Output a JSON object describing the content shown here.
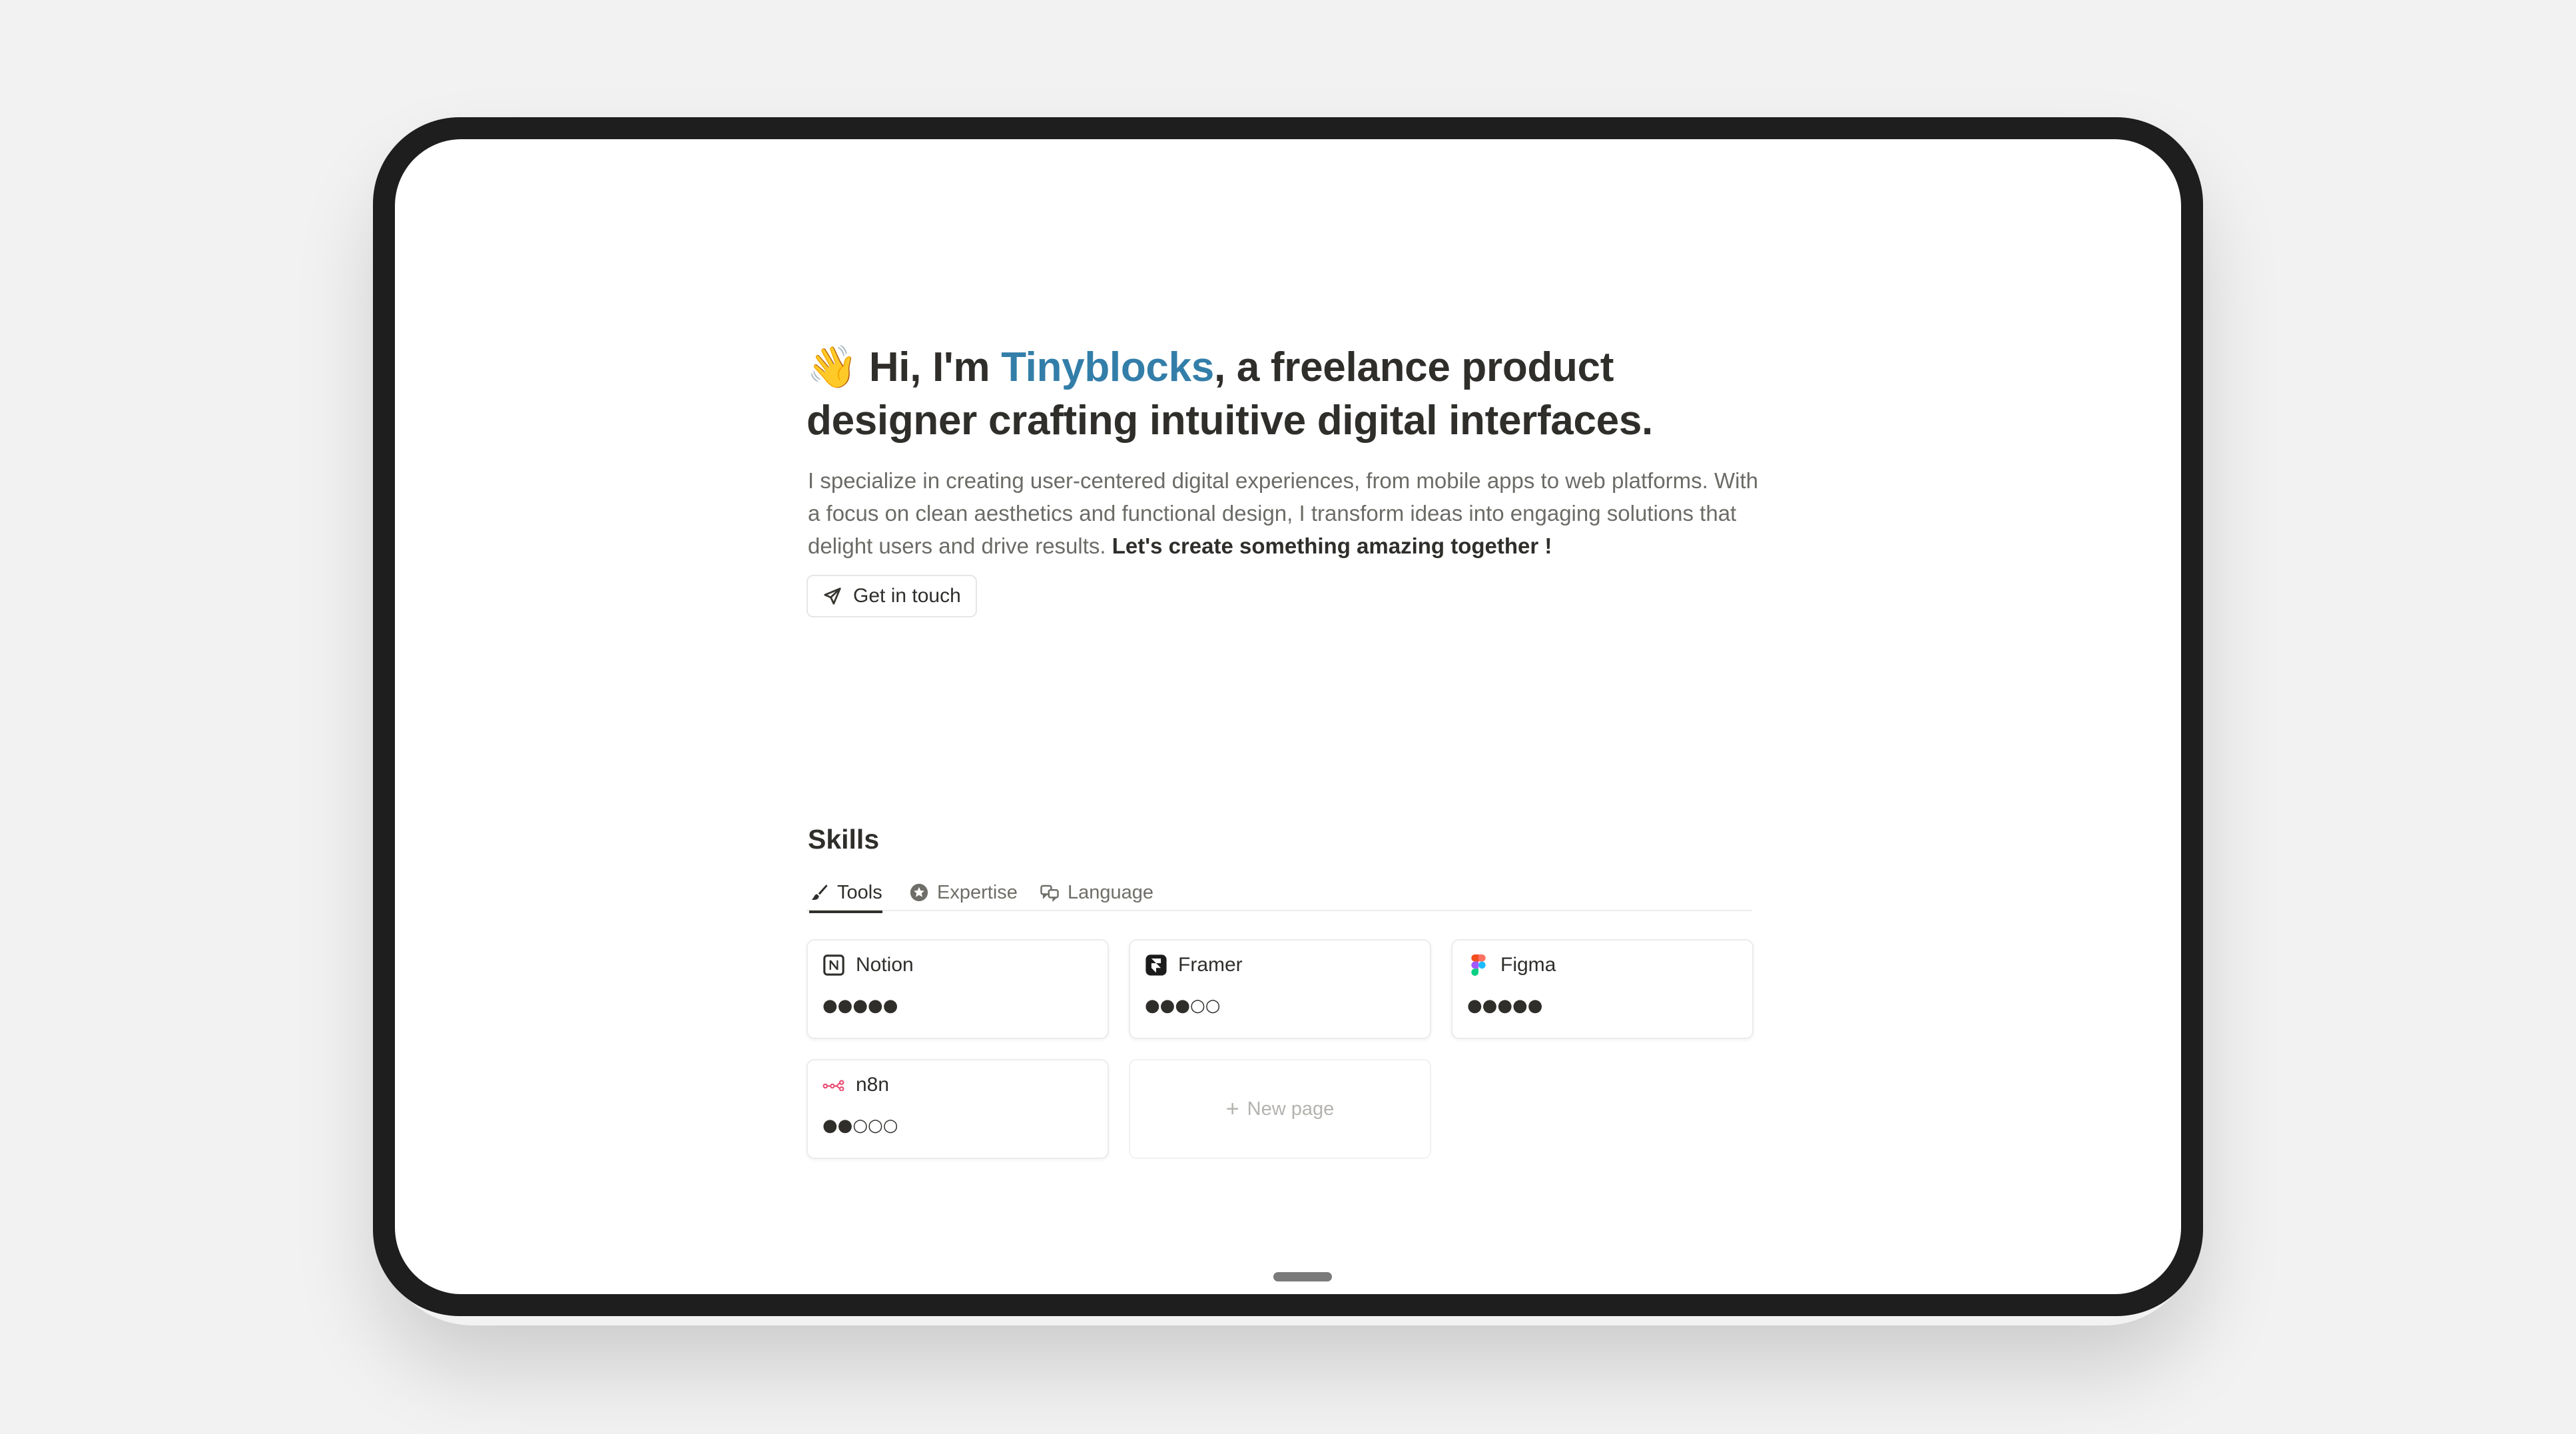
{
  "hero": {
    "wave_emoji": "👋",
    "title_prefix": " Hi, I'm ",
    "name": "Tinyblocks",
    "title_suffix": ", a freelance product designer crafting intuitive digital interfaces.",
    "description": "I specialize in creating user-centered digital experiences, from mobile apps to web platforms. With a focus on clean aesthetics and functional design, I transform ideas into engaging solutions that delight users and drive results. ",
    "description_bold": "Let's create something amazing together !",
    "cta_label": "Get in touch",
    "accent_color": "#337ea9"
  },
  "skills": {
    "title": "Skills",
    "tabs": [
      {
        "label": "Tools",
        "icon": "brush-icon",
        "active": true
      },
      {
        "label": "Expertise",
        "icon": "star-badge-icon",
        "active": false
      },
      {
        "label": "Language",
        "icon": "translate-icon",
        "active": false
      }
    ],
    "cards": [
      {
        "name": "Notion",
        "icon": "notion-icon",
        "rating": "●●●●●",
        "level": 5
      },
      {
        "name": "Framer",
        "icon": "framer-icon",
        "rating": "●●●○○",
        "level": 3
      },
      {
        "name": "Figma",
        "icon": "figma-icon",
        "rating": "●●●●●",
        "level": 5
      },
      {
        "name": "n8n",
        "icon": "n8n-icon",
        "rating": "●●○○○",
        "level": 2
      }
    ],
    "new_page_label": "New page"
  }
}
